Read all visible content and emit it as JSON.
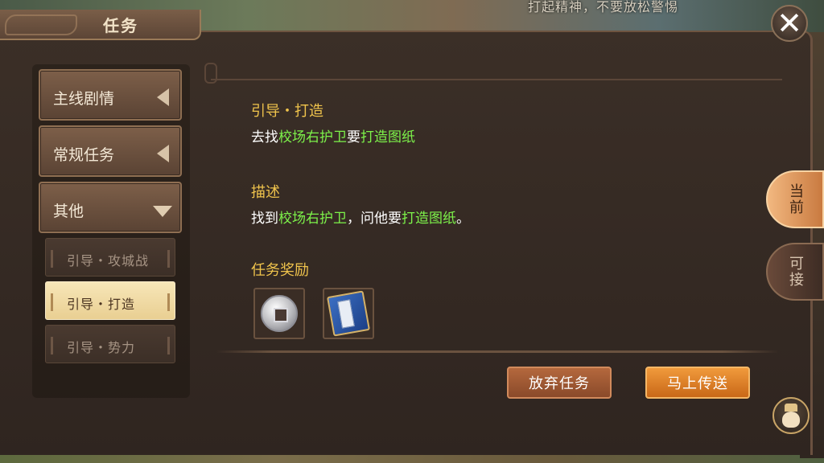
{
  "header": {
    "title": "任务",
    "hint": "打起精神，不要放松警惕",
    "close_icon": "close-icon"
  },
  "categories": [
    {
      "label": "主线剧情",
      "state": "collapsed"
    },
    {
      "label": "常规任务",
      "state": "collapsed"
    },
    {
      "label": "其他",
      "state": "expanded"
    }
  ],
  "subitems": [
    {
      "label": "引导・攻城战",
      "active": false
    },
    {
      "label": "引导・打造",
      "active": true
    },
    {
      "label": "引导・势力",
      "active": false
    }
  ],
  "quest": {
    "name": "引导・打造",
    "goal": {
      "p1": "去找",
      "npc": "校场右护卫",
      "p2": "要",
      "item": "打造图纸"
    },
    "desc_title": "描述",
    "desc": {
      "p1": "找到",
      "npc": "校场右护卫",
      "p2": "，问他要",
      "item": "打造图纸",
      "p3": "。"
    },
    "reward_title": "任务奖励",
    "rewards": [
      {
        "icon": "coin-icon"
      },
      {
        "icon": "book-icon"
      }
    ]
  },
  "actions": {
    "abandon": "放弃任务",
    "teleport": "马上传送"
  },
  "side_tabs": {
    "current": "当前",
    "available": "可接"
  },
  "colors": {
    "highlight": "#7df24a",
    "section_title": "#f0c44c"
  }
}
